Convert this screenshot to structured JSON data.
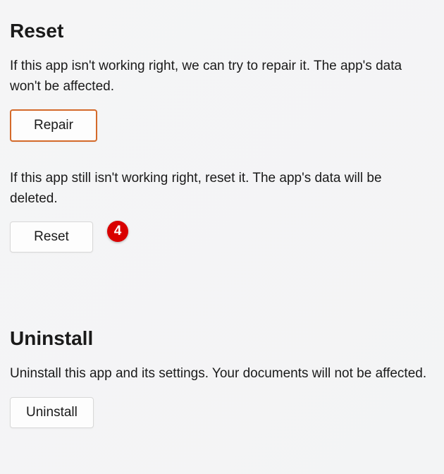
{
  "reset": {
    "heading": "Reset",
    "repair_description": "If this app isn't working right, we can try to repair it. The app's data won't be affected.",
    "repair_button": "Repair",
    "reset_description": "If this app still isn't working right, reset it. The app's data will be deleted.",
    "reset_button": "Reset"
  },
  "uninstall": {
    "heading": "Uninstall",
    "description": "Uninstall this app and its settings. Your documents will not be affected.",
    "button": "Uninstall"
  },
  "callout": {
    "number": "4"
  }
}
